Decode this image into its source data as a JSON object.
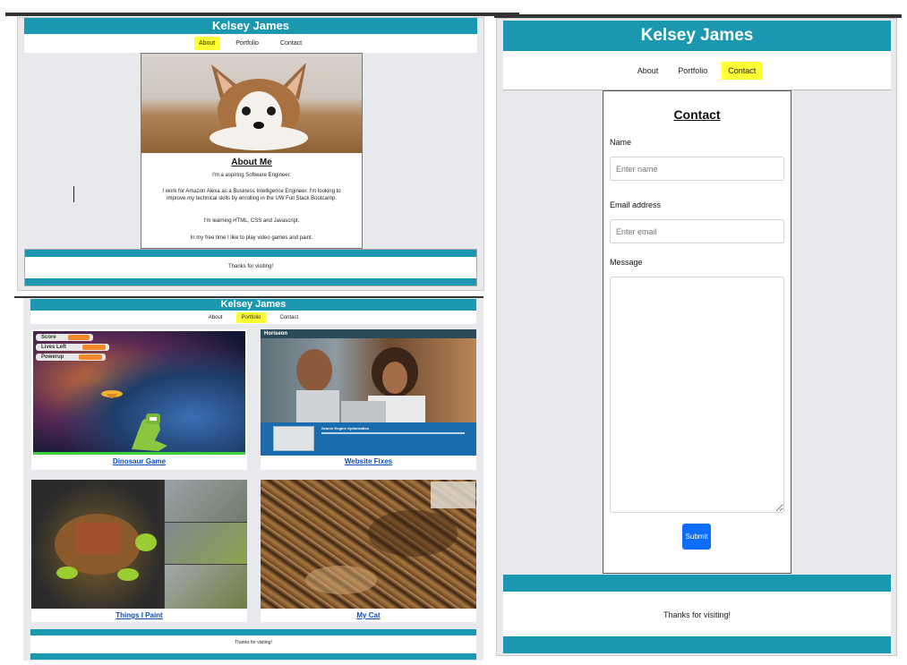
{
  "site": {
    "title": "Kelsey James",
    "footer_text": "Thanks for visiting!"
  },
  "nav": {
    "about": "About",
    "portfolio": "Portfolio",
    "contact": "Contact"
  },
  "about": {
    "heading": "About Me",
    "paragraphs": [
      "I'm a aspiring Software Engineer.",
      "I work for Amazon Alexa as a Business Intelligence Engineer. I'm looking to improve my technical skills by enrolling in the UW Full Stack Bootcamp.",
      "I'm learning HTML, CSS and Javascript.",
      "In my free time I like to play video games and paint."
    ]
  },
  "portfolio": {
    "items": [
      {
        "title": "Dinosaur Game",
        "hud": [
          "Score",
          "Lives Left",
          "Powerup"
        ]
      },
      {
        "title": "Website Fixes",
        "banner": "Horiseon",
        "subtitle": "Search Engine Optimization"
      },
      {
        "title": "Things I Paint"
      },
      {
        "title": "My Cat"
      }
    ]
  },
  "contact": {
    "heading": "Contact",
    "name_label": "Name",
    "name_placeholder": "Enter name",
    "email_label": "Email address",
    "email_placeholder": "Enter email",
    "message_label": "Message",
    "submit_label": "Submit"
  },
  "colors": {
    "header_teal": "#1b98b0",
    "highlight": "#ffff33",
    "link_blue": "#0c4fb5",
    "button_blue": "#0d6efd"
  }
}
